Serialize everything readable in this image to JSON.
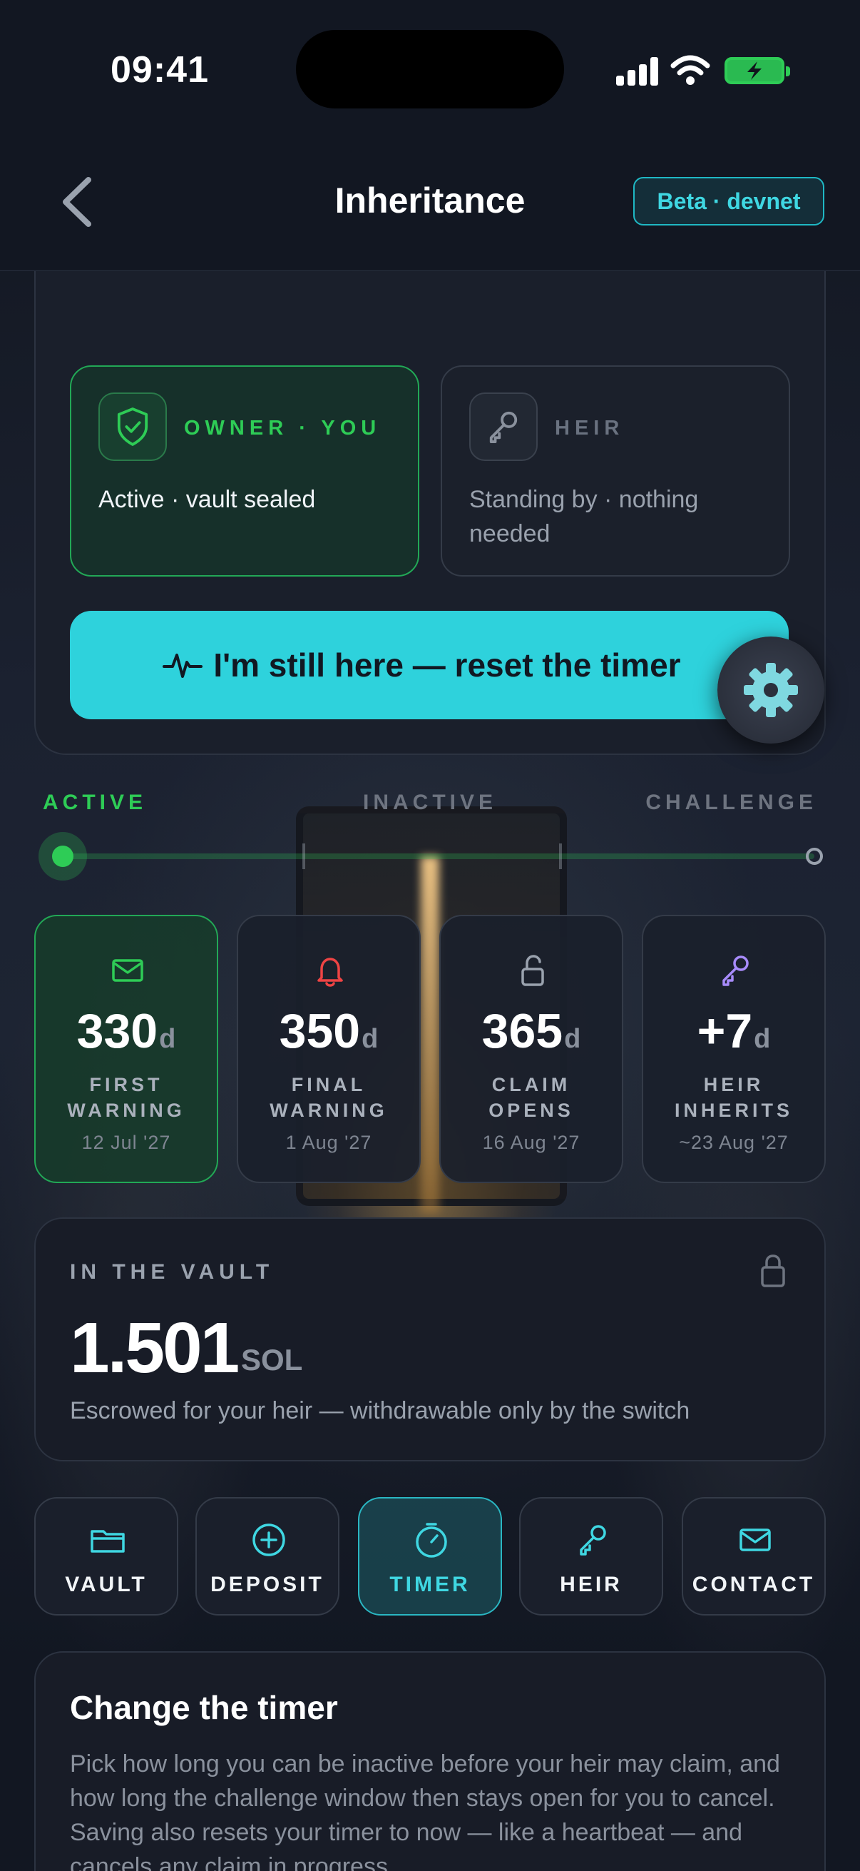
{
  "status_bar": {
    "time": "09:41"
  },
  "header": {
    "title": "Inheritance",
    "badge": "Beta · devnet"
  },
  "roles": {
    "owner": {
      "label": "OWNER · YOU",
      "status": "Active · vault sealed"
    },
    "heir": {
      "label": "HEIR",
      "status": "Standing by · nothing needed"
    }
  },
  "reset_button": {
    "label": "I'm still here — reset the timer"
  },
  "timeline": {
    "phases": [
      "ACTIVE",
      "INACTIVE",
      "CHALLENGE"
    ],
    "current_phase": "ACTIVE"
  },
  "milestones": [
    {
      "icon": "envelope-icon",
      "value": "330",
      "unit": "d",
      "title": "FIRST WARNING",
      "date": "12 Jul '27",
      "color": "#2ecc56"
    },
    {
      "icon": "bell-icon",
      "value": "350",
      "unit": "d",
      "title": "FINAL WARNING",
      "date": "1 Aug '27",
      "color": "#ef4444"
    },
    {
      "icon": "unlock-icon",
      "value": "365",
      "unit": "d",
      "title": "CLAIM OPENS",
      "date": "16 Aug '27",
      "color": "#9aa2ae"
    },
    {
      "icon": "key-icon",
      "value": "+7",
      "unit": "d",
      "title": "HEIR INHERITS",
      "date": "~23 Aug '27",
      "color": "#a78bfa"
    }
  ],
  "vault": {
    "label": "IN THE VAULT",
    "amount": "1.501",
    "unit": "SOL",
    "description": "Escrowed for your heir — withdrawable only by the switch"
  },
  "tabs": [
    {
      "label": "VAULT",
      "icon": "folder-icon",
      "active": false
    },
    {
      "label": "DEPOSIT",
      "icon": "plus-circle-icon",
      "active": false
    },
    {
      "label": "TIMER",
      "icon": "timer-icon",
      "active": true
    },
    {
      "label": "HEIR",
      "icon": "key-icon",
      "active": false
    },
    {
      "label": "CONTACT",
      "icon": "envelope-icon",
      "active": false
    }
  ],
  "timer_card": {
    "title": "Change the timer",
    "description": "Pick how long you can be inactive before your heir may claim, and how long the challenge window then stays open for you to cancel. Saving also resets your timer to now — like a heartbeat — and cancels any claim in progress."
  },
  "colors": {
    "accent": "#2ed2dc",
    "active_green": "#2ecc56",
    "background": "#121722",
    "card": "#1a1f2b"
  }
}
